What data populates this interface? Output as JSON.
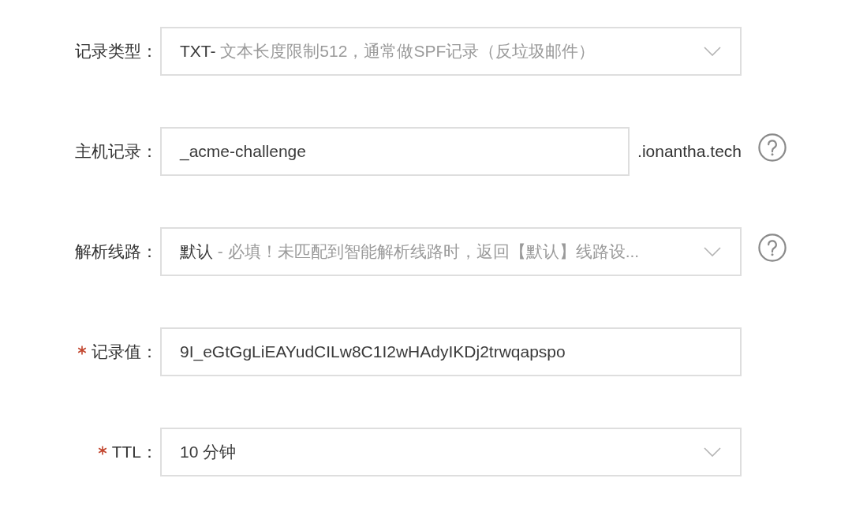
{
  "form": {
    "fields": [
      {
        "kind": "select",
        "label": "记录类型：",
        "required": false,
        "help": false,
        "value": "TXT-",
        "note": "文本长度限制512，通常做SPF记录（反垃圾邮件）"
      },
      {
        "kind": "input",
        "label": "主机记录：",
        "required": false,
        "help": true,
        "value": "_acme-challenge",
        "suffix": ".ionantha.tech"
      },
      {
        "kind": "select",
        "label": "解析线路：",
        "required": false,
        "help": true,
        "value": "默认",
        "note": "- 必填！未匹配到智能解析线路时，返回【默认】线路设..."
      },
      {
        "kind": "input",
        "label": "记录值：",
        "required": true,
        "help": false,
        "value": "9I_eGtGgLiEAYudCILw8C1I2wHAdyIKDj2trwqapspo"
      },
      {
        "kind": "select",
        "label": "TTL：",
        "required": true,
        "help": false,
        "value": "10 分钟"
      }
    ]
  }
}
